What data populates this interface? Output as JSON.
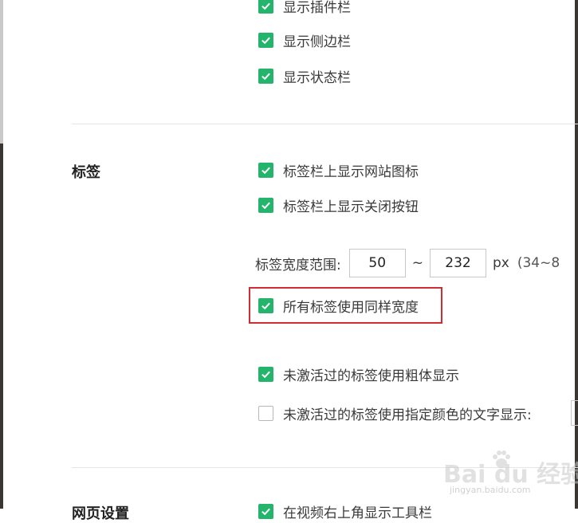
{
  "top_group": {
    "items": [
      {
        "label": "显示插件栏",
        "checked": true
      },
      {
        "label": "显示侧边栏",
        "checked": true
      },
      {
        "label": "显示状态栏",
        "checked": true
      }
    ]
  },
  "tabs_section": {
    "title": "标签",
    "show_site_icon": {
      "label": "标签栏上显示网站图标",
      "checked": true
    },
    "show_close_button": {
      "label": "标签栏上显示关闭按钮",
      "checked": true
    },
    "tab_width": {
      "label": "标签宽度范围:",
      "min": "50",
      "separator": "~",
      "max": "232",
      "unit": "px",
      "range_hint": "(34~8"
    },
    "same_width": {
      "label": "所有标签使用同样宽度",
      "checked": true
    },
    "bold_inactive": {
      "label": "未激活过的标签使用粗体显示",
      "checked": true
    },
    "color_inactive": {
      "label": "未激活过的标签使用指定颜色的文字显示:",
      "checked": false
    }
  },
  "next_section": {
    "title": "网页设置",
    "first_item": {
      "label": "在视频右上角显示工具栏",
      "checked": true
    }
  },
  "watermark": {
    "main": "Bai du 经验",
    "sub": "jingyan.baidu.com"
  },
  "colors": {
    "accent": "#24b46b",
    "highlight": "#cf2d32"
  }
}
